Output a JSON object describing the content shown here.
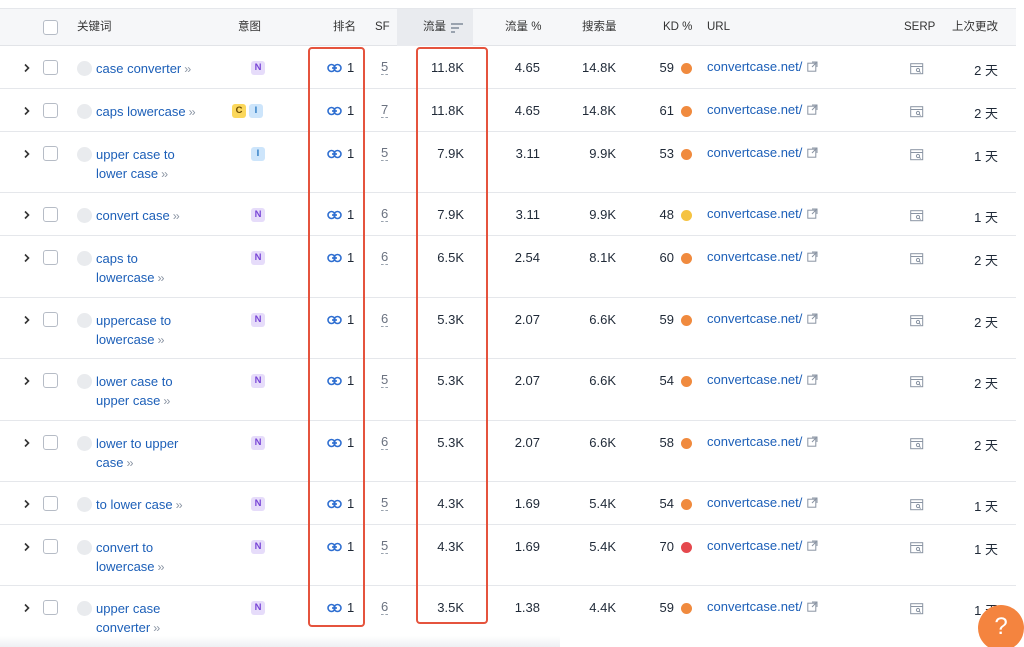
{
  "headers": {
    "keyword": "关键词",
    "intent": "意图",
    "rank": "排名",
    "sf": "SF",
    "traffic": "流量",
    "traffic_pct": "流量 %",
    "volume": "搜索量",
    "kd": "KD %",
    "url": "URL",
    "serp": "SERP",
    "updated": "上次更改"
  },
  "colors": {
    "kd_orange": "#f08a3e",
    "kd_yellow": "#f5c342",
    "kd_red": "#e5484d",
    "highlight_box": "#e5533d"
  },
  "rows": [
    {
      "kw1": "case converter",
      "kw2": "",
      "intent": [
        "N"
      ],
      "rank": "1",
      "sf": "5",
      "traffic": "11.8K",
      "traffic_pct": "4.65",
      "volume": "14.8K",
      "kd": "59",
      "kd_color": "orange",
      "url": "convertcase.net/",
      "updated": "2 天"
    },
    {
      "kw1": "caps lowercase",
      "kw2": "",
      "intent": [
        "C",
        "I"
      ],
      "rank": "1",
      "sf": "7",
      "traffic": "11.8K",
      "traffic_pct": "4.65",
      "volume": "14.8K",
      "kd": "61",
      "kd_color": "orange",
      "url": "convertcase.net/",
      "updated": "2 天"
    },
    {
      "kw1": "upper case to",
      "kw2": "lower case",
      "intent": [
        "I"
      ],
      "rank": "1",
      "sf": "5",
      "traffic": "7.9K",
      "traffic_pct": "3.11",
      "volume": "9.9K",
      "kd": "53",
      "kd_color": "orange",
      "url": "convertcase.net/",
      "updated": "1 天"
    },
    {
      "kw1": "convert case",
      "kw2": "",
      "intent": [
        "N"
      ],
      "rank": "1",
      "sf": "6",
      "traffic": "7.9K",
      "traffic_pct": "3.11",
      "volume": "9.9K",
      "kd": "48",
      "kd_color": "yellow",
      "url": "convertcase.net/",
      "updated": "1 天"
    },
    {
      "kw1": "caps to",
      "kw2": "lowercase",
      "intent": [
        "N"
      ],
      "rank": "1",
      "sf": "6",
      "traffic": "6.5K",
      "traffic_pct": "2.54",
      "volume": "8.1K",
      "kd": "60",
      "kd_color": "orange",
      "url": "convertcase.net/",
      "updated": "2 天"
    },
    {
      "kw1": "uppercase to",
      "kw2": "lowercase",
      "intent": [
        "N"
      ],
      "rank": "1",
      "sf": "6",
      "traffic": "5.3K",
      "traffic_pct": "2.07",
      "volume": "6.6K",
      "kd": "59",
      "kd_color": "orange",
      "url": "convertcase.net/",
      "updated": "2 天"
    },
    {
      "kw1": "lower case to",
      "kw2": "upper case",
      "intent": [
        "N"
      ],
      "rank": "1",
      "sf": "5",
      "traffic": "5.3K",
      "traffic_pct": "2.07",
      "volume": "6.6K",
      "kd": "54",
      "kd_color": "orange",
      "url": "convertcase.net/",
      "updated": "2 天"
    },
    {
      "kw1": "lower to upper",
      "kw2": "case",
      "intent": [
        "N"
      ],
      "rank": "1",
      "sf": "6",
      "traffic": "5.3K",
      "traffic_pct": "2.07",
      "volume": "6.6K",
      "kd": "58",
      "kd_color": "orange",
      "url": "convertcase.net/",
      "updated": "2 天"
    },
    {
      "kw1": "to lower case",
      "kw2": "",
      "intent": [
        "N"
      ],
      "rank": "1",
      "sf": "5",
      "traffic": "4.3K",
      "traffic_pct": "1.69",
      "volume": "5.4K",
      "kd": "54",
      "kd_color": "orange",
      "url": "convertcase.net/",
      "updated": "1 天"
    },
    {
      "kw1": "convert to",
      "kw2": "lowercase",
      "intent": [
        "N"
      ],
      "rank": "1",
      "sf": "5",
      "traffic": "4.3K",
      "traffic_pct": "1.69",
      "volume": "5.4K",
      "kd": "70",
      "kd_color": "red",
      "url": "convertcase.net/",
      "updated": "1 天"
    },
    {
      "kw1": "upper case",
      "kw2": "converter",
      "intent": [
        "N"
      ],
      "rank": "1",
      "sf": "6",
      "traffic": "3.5K",
      "traffic_pct": "1.38",
      "volume": "4.4K",
      "kd": "59",
      "kd_color": "orange",
      "url": "convertcase.net/",
      "updated": "1 天"
    }
  ],
  "help_button": "?"
}
